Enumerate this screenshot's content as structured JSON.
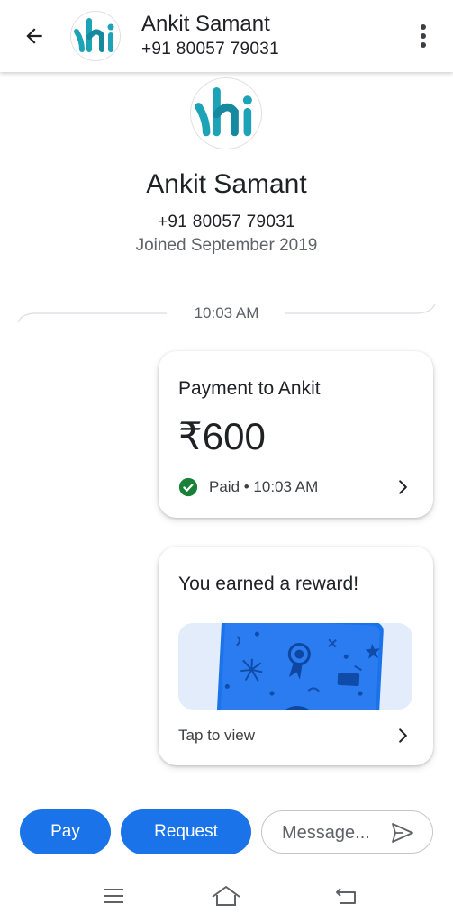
{
  "header": {
    "contact_name": "Ankit Samant",
    "contact_phone": "+91 80057 79031",
    "back_icon": "arrow-left-icon",
    "menu_icon": "more-vertical-icon"
  },
  "profile": {
    "name": "Ankit Samant",
    "phone": "+91 80057 79031",
    "joined": "Joined September 2019"
  },
  "conversation": {
    "timestamp": "10:03 AM",
    "payment_card": {
      "title": "Payment to Ankit",
      "amount": "₹600",
      "status": "Paid • 10:03 AM",
      "status_icon": "check-circle-icon",
      "status_color": "#188038"
    },
    "reward_card": {
      "title": "You earned a reward!",
      "action": "Tap to view",
      "scratch_card_color": "#1a73e8",
      "banner_color": "#e3ecfb"
    }
  },
  "composer": {
    "pay_label": "Pay",
    "request_label": "Request",
    "message_placeholder": "Message...",
    "send_icon": "send-icon"
  },
  "colors": {
    "accent": "#1a73e8",
    "logo_teal": "#1ca3b8"
  }
}
